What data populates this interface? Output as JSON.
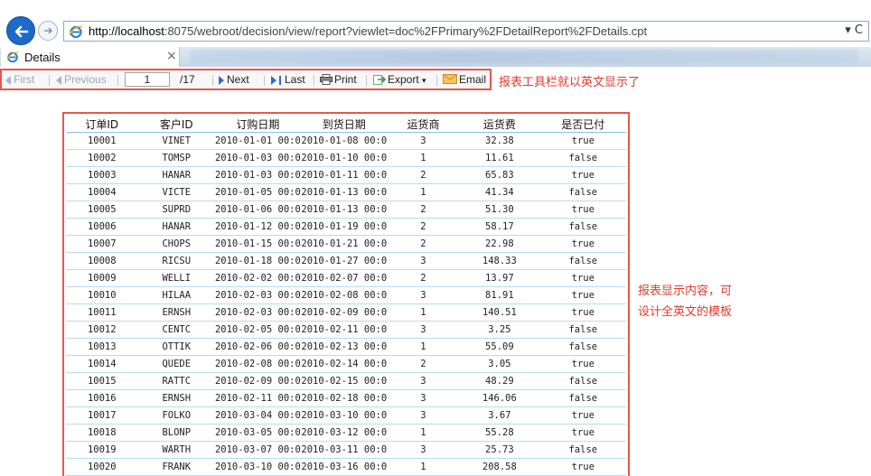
{
  "browser": {
    "url_host": "http://localhost",
    "url_rest": ":8075/webroot/decision/view/report?viewlet=doc%2FPrimary%2FDetailReport%2FDetails.cpt",
    "url_controls": "▾ C",
    "tab_title": "Details",
    "tab_close": "×"
  },
  "toolbar": {
    "first": "First",
    "previous": "Previous",
    "page_value": "1",
    "page_total": "/17",
    "next": "Next",
    "last": "Last",
    "print": "Print",
    "export": "Export",
    "email": "Email"
  },
  "notes": {
    "toolbar_note": "报表工具栏就以英文显示了",
    "content_note_line1": "报表显示内容，可",
    "content_note_line2": "设计全英文的模板"
  },
  "table": {
    "headers": [
      "订单ID",
      "客户ID",
      "订购日期",
      "到货日期",
      "运货商",
      "运货费",
      "是否已付"
    ],
    "rows": [
      [
        "10001",
        "VINET",
        "2010-01-01 00:0",
        "2010-01-08 00:0",
        "3",
        "32.38",
        "true"
      ],
      [
        "10002",
        "TOMSP",
        "2010-01-03 00:0",
        "2010-01-10 00:0",
        "1",
        "11.61",
        "false"
      ],
      [
        "10003",
        "HANAR",
        "2010-01-03 00:0",
        "2010-01-11 00:0",
        "2",
        "65.83",
        "true"
      ],
      [
        "10004",
        "VICTE",
        "2010-01-05 00:0",
        "2010-01-13 00:0",
        "1",
        "41.34",
        "false"
      ],
      [
        "10005",
        "SUPRD",
        "2010-01-06 00:0",
        "2010-01-13 00:0",
        "2",
        "51.30",
        "true"
      ],
      [
        "10006",
        "HANAR",
        "2010-01-12 00:0",
        "2010-01-19 00:0",
        "2",
        "58.17",
        "false"
      ],
      [
        "10007",
        "CHOPS",
        "2010-01-15 00:0",
        "2010-01-21 00:0",
        "2",
        "22.98",
        "true"
      ],
      [
        "10008",
        "RICSU",
        "2010-01-18 00:0",
        "2010-01-27 00:0",
        "3",
        "148.33",
        "false"
      ],
      [
        "10009",
        "WELLI",
        "2010-02-02 00:0",
        "2010-02-07 00:0",
        "2",
        "13.97",
        "true"
      ],
      [
        "10010",
        "HILAA",
        "2010-02-03 00:0",
        "2010-02-08 00:0",
        "3",
        "81.91",
        "true"
      ],
      [
        "10011",
        "ERNSH",
        "2010-02-03 00:0",
        "2010-02-09 00:0",
        "1",
        "140.51",
        "true"
      ],
      [
        "10012",
        "CENTC",
        "2010-02-05 00:0",
        "2010-02-11 00:0",
        "3",
        "3.25",
        "false"
      ],
      [
        "10013",
        "OTTIK",
        "2010-02-06 00:0",
        "2010-02-13 00:0",
        "1",
        "55.09",
        "false"
      ],
      [
        "10014",
        "QUEDE",
        "2010-02-08 00:0",
        "2010-02-14 00:0",
        "2",
        "3.05",
        "true"
      ],
      [
        "10015",
        "RATTC",
        "2010-02-09 00:0",
        "2010-02-15 00:0",
        "3",
        "48.29",
        "false"
      ],
      [
        "10016",
        "ERNSH",
        "2010-02-11 00:0",
        "2010-02-18 00:0",
        "3",
        "146.06",
        "false"
      ],
      [
        "10017",
        "FOLKO",
        "2010-03-04 00:0",
        "2010-03-10 00:0",
        "3",
        "3.67",
        "true"
      ],
      [
        "10018",
        "BLONP",
        "2010-03-05 00:0",
        "2010-03-12 00:0",
        "1",
        "55.28",
        "true"
      ],
      [
        "10019",
        "WARTH",
        "2010-03-07 00:0",
        "2010-03-11 00:0",
        "3",
        "25.73",
        "false"
      ],
      [
        "10020",
        "FRANK",
        "2010-03-10 00:0",
        "2010-03-16 00:0",
        "1",
        "208.58",
        "true"
      ]
    ]
  },
  "colors": {
    "highlight_border": "#e4584a",
    "note_text": "#e23a2a",
    "row_line": "#b7dcf2"
  }
}
